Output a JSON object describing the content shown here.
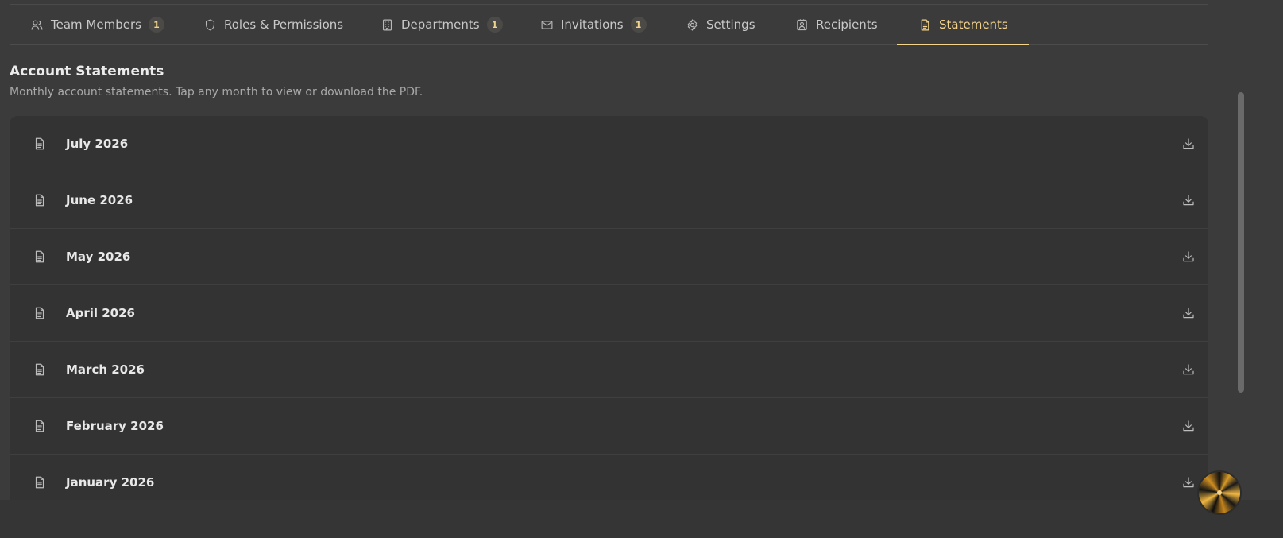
{
  "tabs": [
    {
      "label": "Team Members",
      "badge": "1",
      "icon": "users-icon"
    },
    {
      "label": "Roles & Permissions",
      "icon": "shield-icon"
    },
    {
      "label": "Departments",
      "badge": "1",
      "icon": "building-icon"
    },
    {
      "label": "Invitations",
      "badge": "1",
      "icon": "mail-icon"
    },
    {
      "label": "Settings",
      "icon": "gear-icon"
    },
    {
      "label": "Recipients",
      "icon": "contact-icon"
    },
    {
      "label": "Statements",
      "icon": "document-icon",
      "active": true
    }
  ],
  "section": {
    "title": "Account Statements",
    "subtitle": "Monthly account statements. Tap any month to view or download the PDF."
  },
  "statements": [
    {
      "label": "July 2026"
    },
    {
      "label": "June 2026"
    },
    {
      "label": "May 2026"
    },
    {
      "label": "April 2026"
    },
    {
      "label": "March 2026"
    },
    {
      "label": "February 2026"
    },
    {
      "label": "January 2026"
    }
  ],
  "colors": {
    "accent": "#f5d48c",
    "background": "#3b3b3b",
    "card": "#333333"
  }
}
